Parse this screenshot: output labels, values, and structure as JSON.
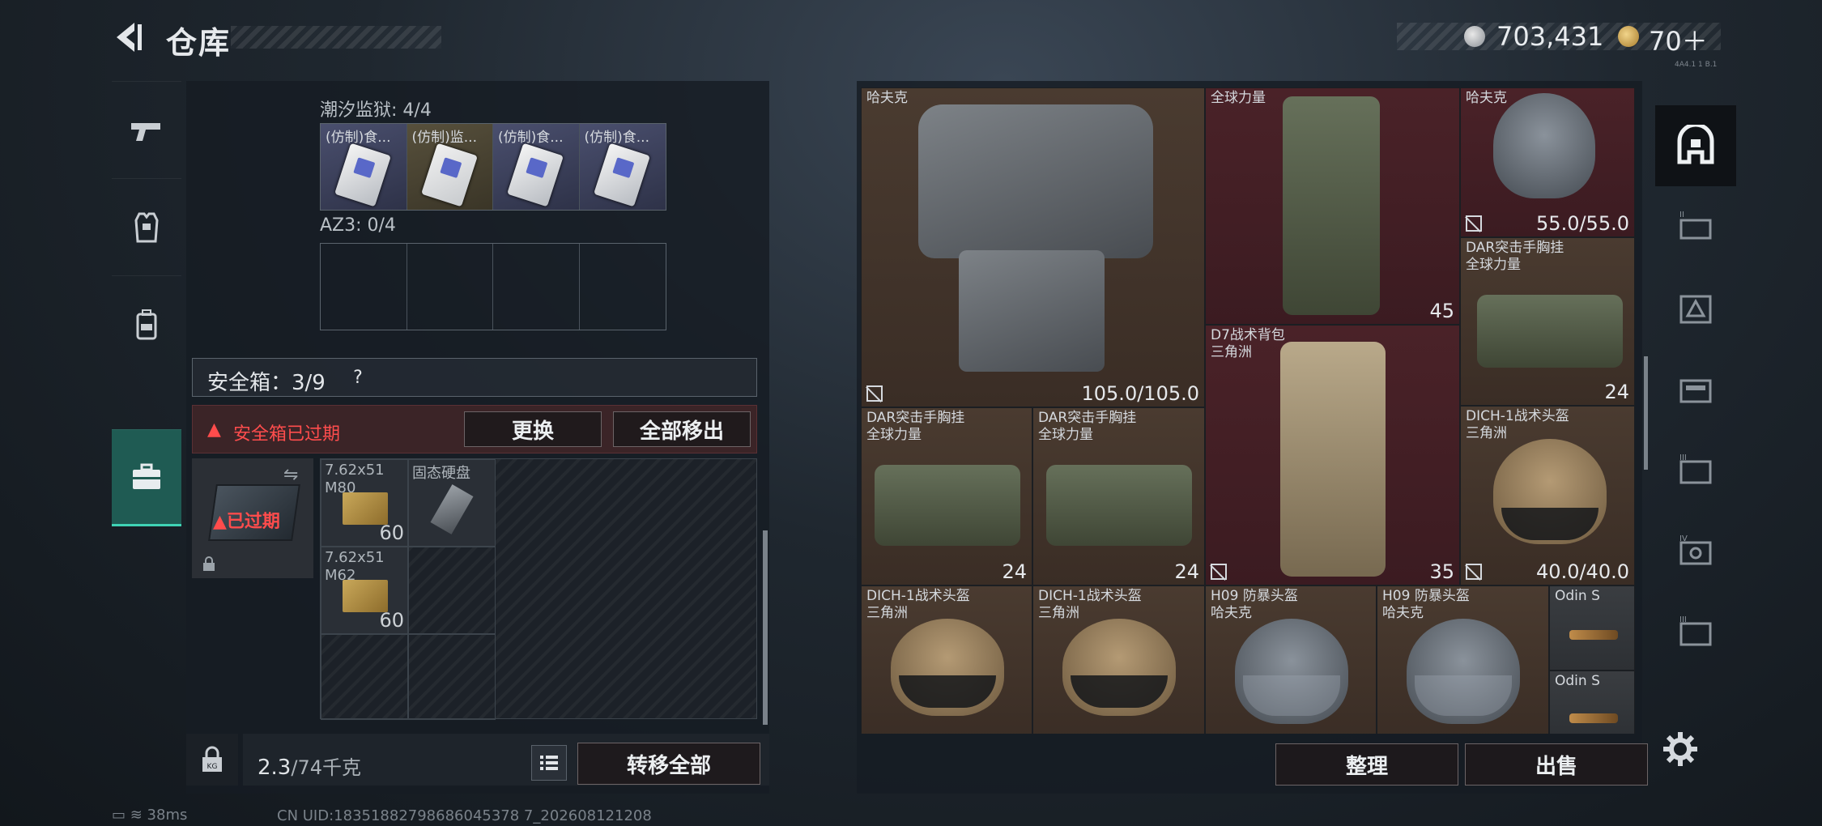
{
  "header": {
    "title": "仓库",
    "silver": "703,431",
    "gold": "70＋",
    "small_tag": "4A4.1 1 B.1"
  },
  "left_panel": {
    "section1": {
      "label": "潮汐监狱: 4/4",
      "slots": [
        "(仿制)食...",
        "(仿制)监...",
        "(仿制)食...",
        "(仿制)食..."
      ]
    },
    "section2": {
      "label": "AZ3: 0/4"
    },
    "safe_box": {
      "label": "安全箱：3/9",
      "help": "?",
      "warning": "安全箱已过期",
      "replace_label": "更换",
      "move_all_label": "全部移出",
      "expired_tag": "已过期",
      "cells": [
        {
          "name": "7.62x51",
          "sub": "M80",
          "count": "60"
        },
        {
          "name": "固态硬盘",
          "sub": "",
          "count": ""
        },
        {
          "name": "7.62x51",
          "sub": "M62",
          "count": "60"
        }
      ]
    },
    "weight": {
      "value": "2.3",
      "unit": "/74千克"
    },
    "transfer_all_label": "转移全部"
  },
  "status": {
    "ping": "38ms",
    "uid": "CN UID:18351882798686045378 7_202608121208"
  },
  "storage": {
    "items": [
      {
        "name": "哈夫克",
        "value": "105.0/105.0"
      },
      {
        "name": "全球力量",
        "value": "45"
      },
      {
        "name": "哈夫克",
        "value": "55.0/55.0"
      },
      {
        "name": "DAR突击手胸挂\n全球力量",
        "value": "24"
      },
      {
        "name": "D7战术背包\n三角洲",
        "value": "35"
      },
      {
        "name": "DAR突击手胸挂\n全球力量",
        "value": "24"
      },
      {
        "name": "DAR突击手胸挂\n全球力量",
        "value": "24"
      },
      {
        "name": "DICH-1战术头盔\n三角洲",
        "value": "40.0/40.0"
      },
      {
        "name": "DICH-1战术头盔\n三角洲",
        "value": ""
      },
      {
        "name": "DICH-1战术头盔\n三角洲",
        "value": ""
      },
      {
        "name": "H09 防暴头盔\n哈夫克",
        "value": ""
      },
      {
        "name": "H09 防暴头盔\n哈夫克",
        "value": ""
      },
      {
        "name": "Odin S",
        "value": ""
      },
      {
        "name": "Odin S",
        "value": ""
      }
    ],
    "arrange_label": "整理",
    "sell_label": "出售"
  }
}
